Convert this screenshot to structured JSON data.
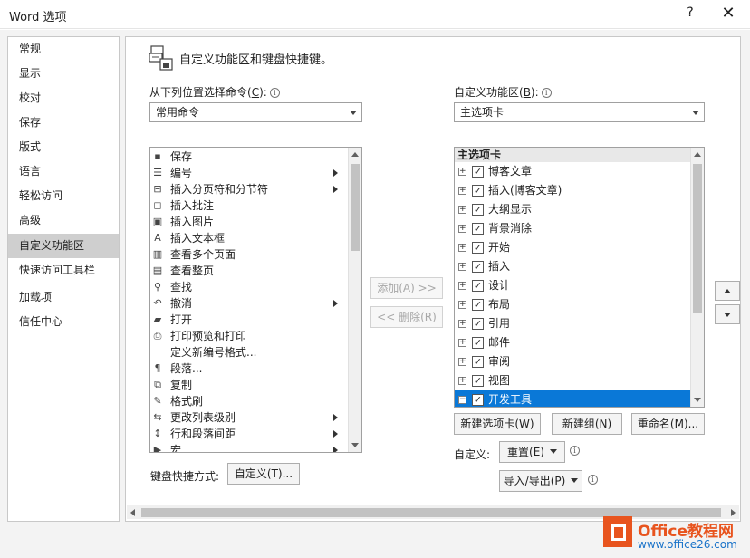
{
  "window": {
    "title": "Word 选项",
    "help": "?",
    "close": "✕"
  },
  "nav": {
    "items": [
      "常规",
      "显示",
      "校对",
      "保存",
      "版式",
      "语言",
      "轻松访问",
      "高级",
      "自定义功能区",
      "快速访问工具栏",
      "加载项",
      "信任中心"
    ],
    "selected": "自定义功能区"
  },
  "header": {
    "title": "自定义功能区和键盘快捷键。"
  },
  "left": {
    "label_prefix": "从下列位置选择命令(",
    "label_key": "C",
    "label_suffix": "):",
    "dropdown_value": "常用命令",
    "commands": [
      {
        "label": "保存",
        "icon": "save-icon",
        "glyph": "▪",
        "submenu": false
      },
      {
        "label": "编号",
        "icon": "numbering-icon",
        "glyph": "☰",
        "submenu": true
      },
      {
        "label": "插入分页符和分节符",
        "icon": "page-break-icon",
        "glyph": "⊟",
        "submenu": true
      },
      {
        "label": "插入批注",
        "icon": "comment-icon",
        "glyph": "◻",
        "submenu": false
      },
      {
        "label": "插入图片",
        "icon": "picture-icon",
        "glyph": "▣",
        "submenu": false
      },
      {
        "label": "插入文本框",
        "icon": "textbox-icon",
        "glyph": "A",
        "submenu": false
      },
      {
        "label": "查看多个页面",
        "icon": "multiple-pages-icon",
        "glyph": "▥",
        "submenu": false
      },
      {
        "label": "查看整页",
        "icon": "whole-page-icon",
        "glyph": "▤",
        "submenu": false
      },
      {
        "label": "查找",
        "icon": "find-icon",
        "glyph": "⚲",
        "submenu": false
      },
      {
        "label": "撤消",
        "icon": "undo-icon",
        "glyph": "↶",
        "submenu": true
      },
      {
        "label": "打开",
        "icon": "open-folder-icon",
        "glyph": "▰",
        "submenu": false
      },
      {
        "label": "打印预览和打印",
        "icon": "print-preview-icon",
        "glyph": "⎙",
        "submenu": false
      },
      {
        "label": "定义新编号格式...",
        "icon": "",
        "glyph": "",
        "submenu": false
      },
      {
        "label": "段落...",
        "icon": "paragraph-icon",
        "glyph": "¶",
        "submenu": false
      },
      {
        "label": "复制",
        "icon": "copy-icon",
        "glyph": "⧉",
        "submenu": false
      },
      {
        "label": "格式刷",
        "icon": "format-painter-icon",
        "glyph": "✎",
        "submenu": false
      },
      {
        "label": "更改列表级别",
        "icon": "list-level-icon",
        "glyph": "⇆",
        "submenu": true
      },
      {
        "label": "行和段落间距",
        "icon": "line-spacing-icon",
        "glyph": "↕",
        "submenu": true
      },
      {
        "label": "宏",
        "icon": "macro-icon",
        "glyph": "▶",
        "submenu": true
      }
    ],
    "shortcut_label": "键盘快捷方式:",
    "shortcut_button": "自定义(T)..."
  },
  "middle": {
    "add_button": "添加(A) >>",
    "remove_button": "<< 删除(R)"
  },
  "right": {
    "label_prefix": "自定义功能区(",
    "label_key": "B",
    "label_suffix": "):",
    "dropdown_value": "主选项卡",
    "tree_header": "主选项卡",
    "tabs": [
      {
        "label": "博客文章",
        "checked": true,
        "expander": "+",
        "selected": false
      },
      {
        "label": "插入(博客文章)",
        "checked": true,
        "expander": "+",
        "selected": false
      },
      {
        "label": "大纲显示",
        "checked": true,
        "expander": "+",
        "selected": false
      },
      {
        "label": "背景消除",
        "checked": true,
        "expander": "+",
        "selected": false
      },
      {
        "label": "开始",
        "checked": true,
        "expander": "+",
        "selected": false
      },
      {
        "label": "插入",
        "checked": true,
        "expander": "+",
        "selected": false
      },
      {
        "label": "设计",
        "checked": true,
        "expander": "+",
        "selected": false
      },
      {
        "label": "布局",
        "checked": true,
        "expander": "+",
        "selected": false
      },
      {
        "label": "引用",
        "checked": true,
        "expander": "+",
        "selected": false
      },
      {
        "label": "邮件",
        "checked": true,
        "expander": "+",
        "selected": false
      },
      {
        "label": "审阅",
        "checked": true,
        "expander": "+",
        "selected": false
      },
      {
        "label": "视图",
        "checked": true,
        "expander": "+",
        "selected": false
      },
      {
        "label": "开发工具",
        "checked": true,
        "expander": "−",
        "selected": true
      }
    ],
    "new_tab_button": "新建选项卡(W)",
    "new_group_button": "新建组(N)",
    "rename_button": "重命名(M)...",
    "customize_label": "自定义:",
    "reset_button": "重置(E)",
    "import_export_button": "导入/导出(P)"
  },
  "watermark": {
    "title": "Office教程网",
    "url": "www.office26.com"
  },
  "colors": {
    "selection": "#0a78d7",
    "watermark_orange": "#e8541e",
    "watermark_blue": "#1a73c9"
  }
}
